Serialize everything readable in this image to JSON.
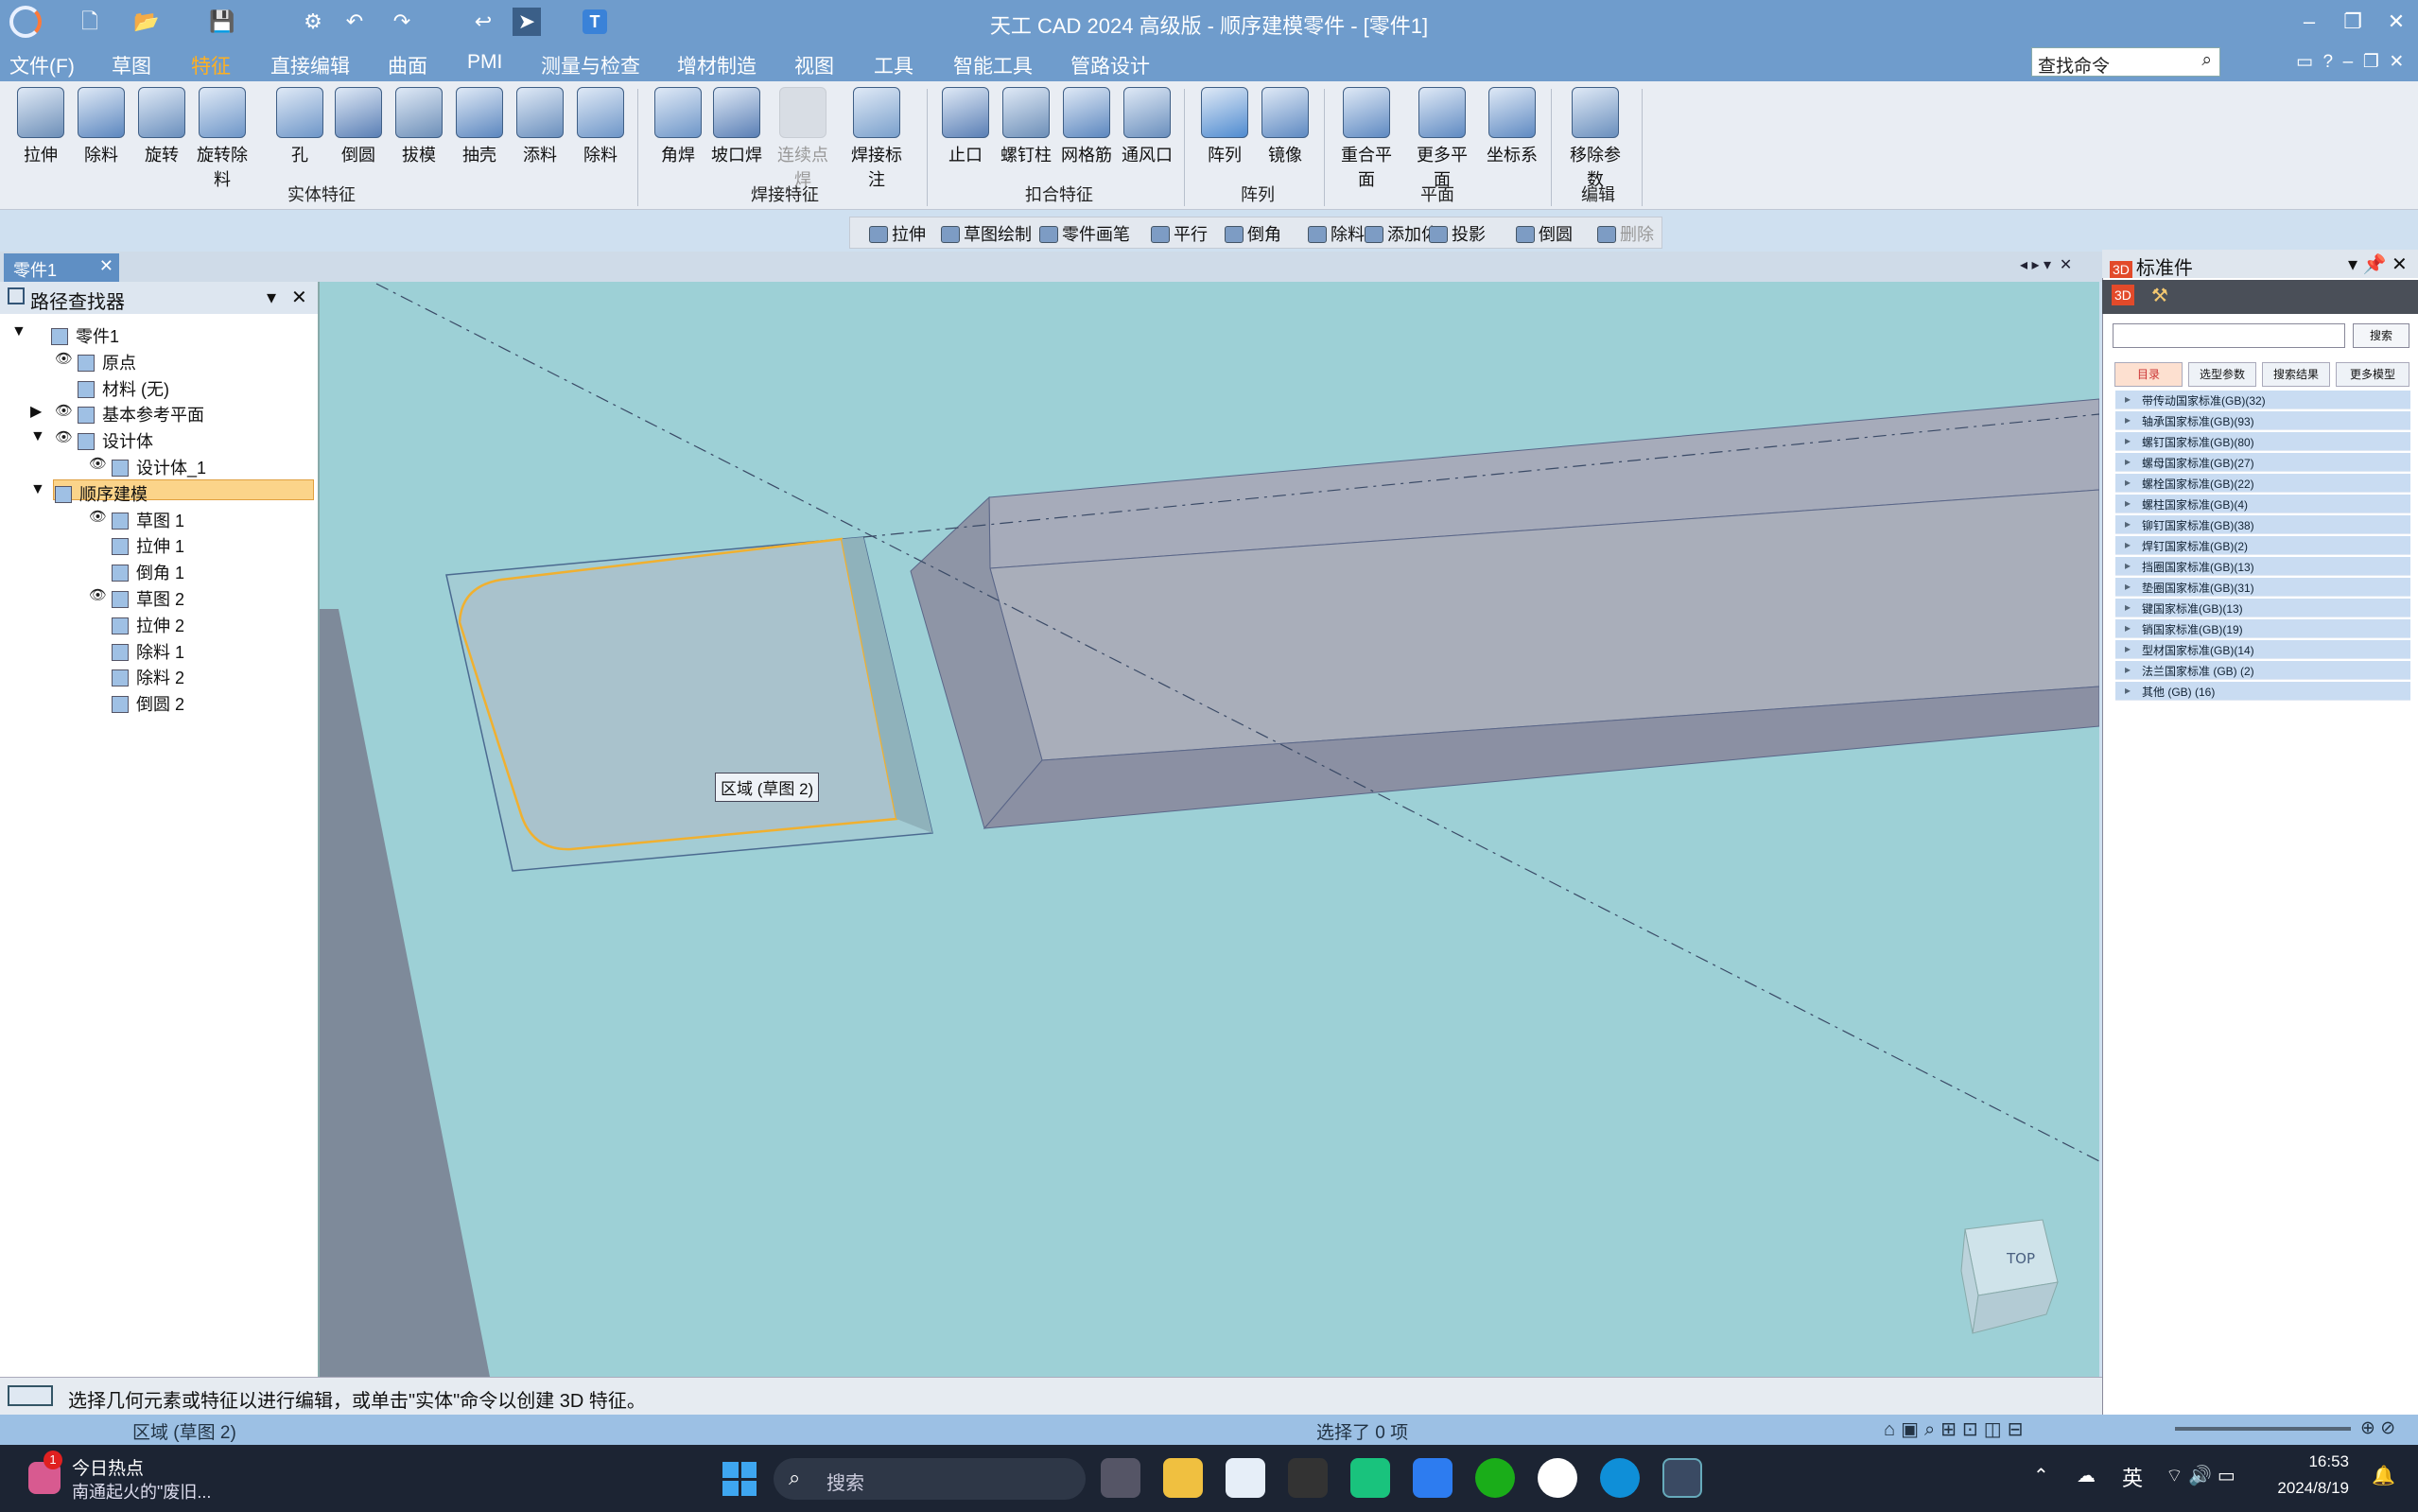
{
  "title": "天工 CAD 2024 高级版 - 顺序建模零件 - [零件1]",
  "menu": [
    "文件(F)",
    "草图",
    "特征",
    "直接编辑",
    "曲面",
    "PMI",
    "测量与检查",
    "增材制造",
    "视图",
    "工具",
    "智能工具",
    "管路设计"
  ],
  "search_cmd": "查找命令",
  "ribbon": {
    "solid": [
      "拉伸",
      "除料",
      "旋转",
      "旋转除料",
      "孔",
      "倒圆",
      "拔模",
      "抽壳",
      "添料",
      "除料"
    ],
    "solid_group": "实体特征",
    "weld": [
      "角焊",
      "坡口焊",
      "连续点焊",
      "焊接标注"
    ],
    "weld_group": "焊接特征",
    "snap": [
      "止口",
      "螺钉柱",
      "网格筋",
      "通风口"
    ],
    "snap_group": "扣合特征",
    "array": [
      "阵列",
      "镜像"
    ],
    "array_group": "阵列",
    "plane": [
      "重合平面",
      "更多平面",
      "坐标系"
    ],
    "plane_group": "平面",
    "edit": [
      "移除参数"
    ],
    "edit_group": "编辑"
  },
  "toolbar2": [
    "拉伸",
    "草图绘制",
    "零件画笔",
    "平行",
    "倒角",
    "除料",
    "添加体",
    "投影",
    "倒圆",
    "删除"
  ],
  "doc_tab": "零件1",
  "left_panel": {
    "title": "路径查找器",
    "tree": [
      {
        "label": "零件1"
      },
      {
        "label": "原点"
      },
      {
        "label": "材料 (无)"
      },
      {
        "label": "基本参考平面"
      },
      {
        "label": "设计体"
      },
      {
        "label": "设计体_1"
      },
      {
        "label": "顺序建模"
      },
      {
        "label": "草图 1"
      },
      {
        "label": "拉伸 1"
      },
      {
        "label": "倒角 1"
      },
      {
        "label": "草图 2"
      },
      {
        "label": "拉伸 2"
      },
      {
        "label": "除料 1"
      },
      {
        "label": "除料 2"
      },
      {
        "label": "倒圆 2"
      }
    ]
  },
  "viewport": {
    "tooltip": "区域 (草图 2)",
    "view_cube": "TOP"
  },
  "right_panel": {
    "title": "标准件",
    "search_btn": "搜索",
    "tabs": [
      "目录",
      "选型参数",
      "搜索结果",
      "更多模型"
    ],
    "categories": [
      "带传动国家标准(GB)(32)",
      "轴承国家标准(GB)(93)",
      "螺钉国家标准(GB)(80)",
      "螺母国家标准(GB)(27)",
      "螺栓国家标准(GB)(22)",
      "螺柱国家标准(GB)(4)",
      "铆钉国家标准(GB)(38)",
      "焊钉国家标准(GB)(2)",
      "挡圈国家标准(GB)(13)",
      "垫圈国家标准(GB)(31)",
      "键国家标准(GB)(13)",
      "销国家标准(GB)(19)",
      "型材国家标准(GB)(14)",
      "法兰国家标准 (GB) (2)",
      "其他 (GB) (16)"
    ]
  },
  "status": {
    "prompt": "选择几何元素或特征以进行编辑，或单击\"实体\"命令以创建 3D 特征。",
    "left": "区域 (草图 2)",
    "center": "选择了 0 项"
  },
  "taskbar": {
    "news_title": "今日热点",
    "news_sub": "南通起火的\"废旧...",
    "badge": "1",
    "search": "搜索",
    "ime": "英",
    "time": "16:53",
    "date": "2024/8/19"
  }
}
